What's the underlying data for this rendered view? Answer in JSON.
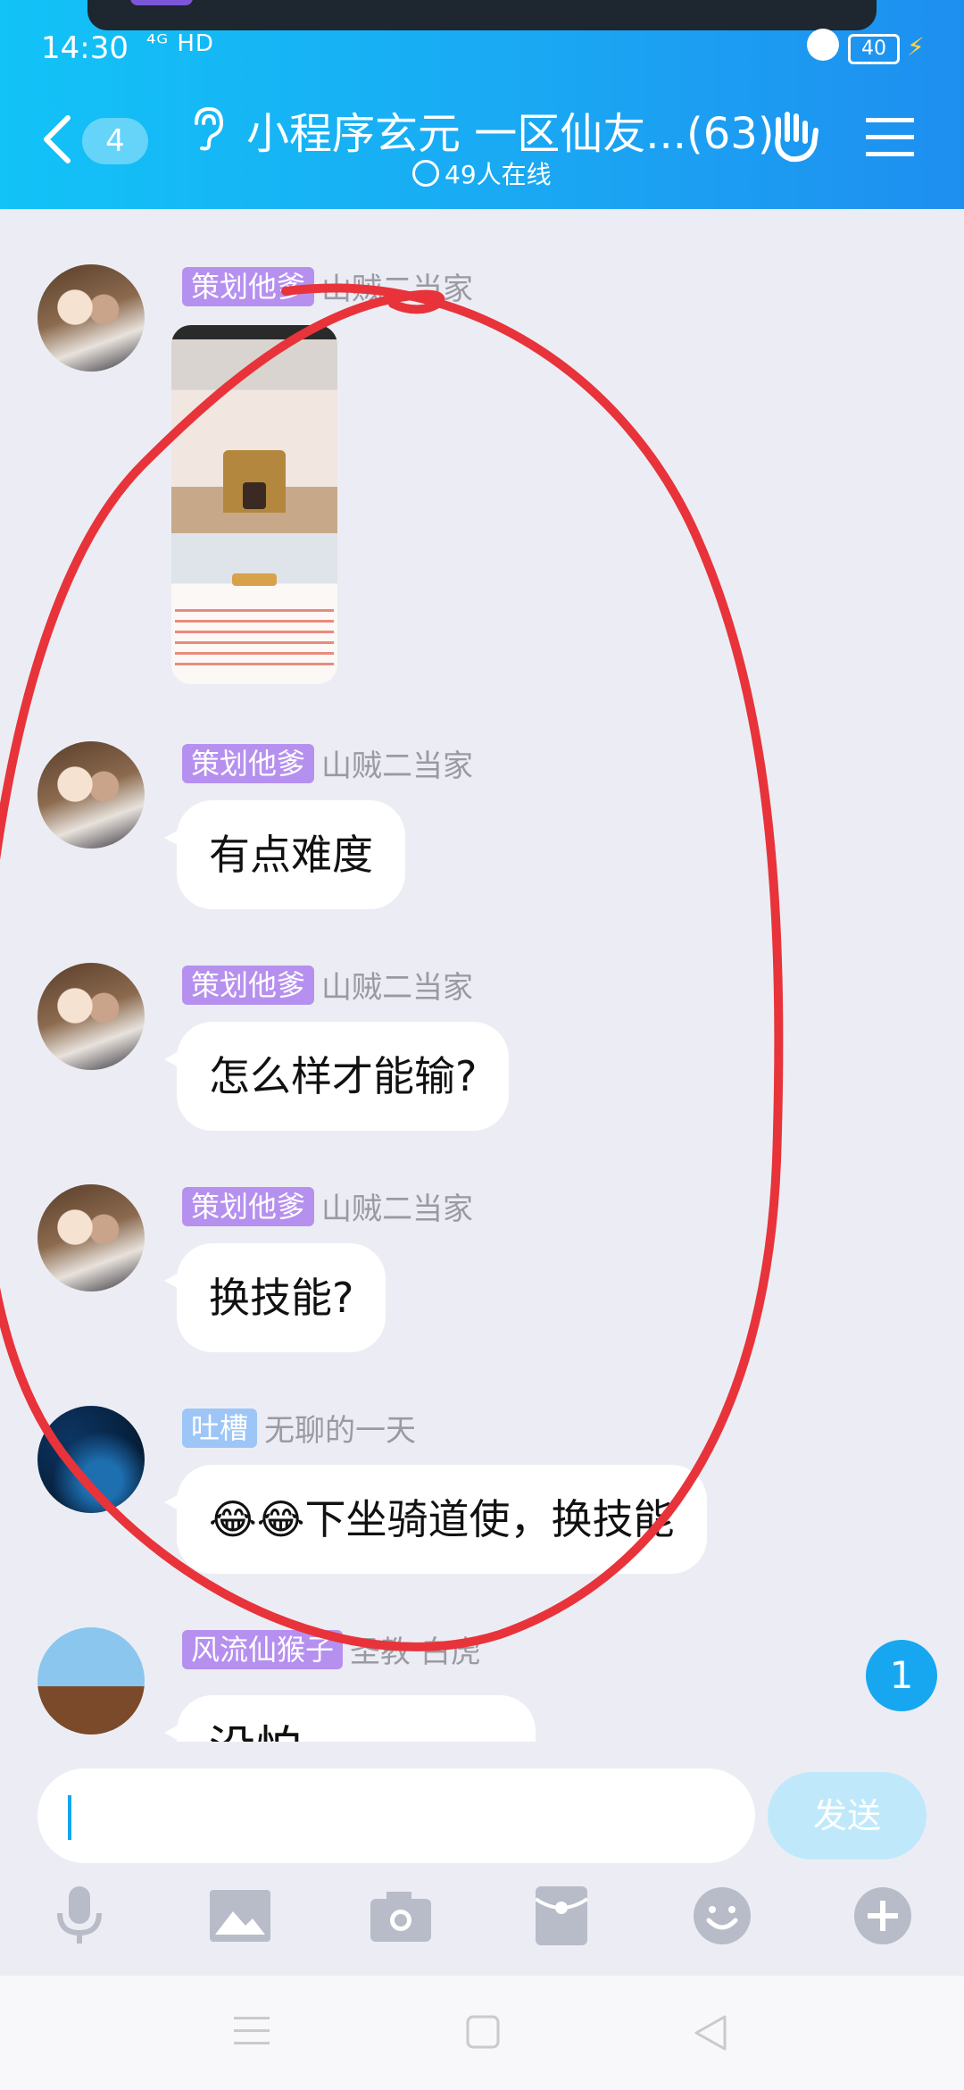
{
  "status_bar": {
    "time": "14:30",
    "network": "⁴ᴳ HD",
    "battery": "40"
  },
  "header": {
    "back_count": "4",
    "title": "小程序玄元 一区仙友...(63)",
    "online": "49人在线"
  },
  "messages": [
    {
      "tag": "策划他爹",
      "tag_color": "#b690ef",
      "nickname": "山贼二当家",
      "type": "image"
    },
    {
      "tag": "策划他爹",
      "tag_color": "#b690ef",
      "nickname": "山贼二当家",
      "text": "有点难度"
    },
    {
      "tag": "策划他爹",
      "tag_color": "#b690ef",
      "nickname": "山贼二当家",
      "text": "怎么样才能输?"
    },
    {
      "tag": "策划他爹",
      "tag_color": "#b690ef",
      "nickname": "山贼二当家",
      "text": "换技能?"
    },
    {
      "tag": "吐槽",
      "tag_color": "#9dc6f6",
      "nickname": "无聊的一天",
      "text": "😂😂下坐骑道使，换技能"
    },
    {
      "tag": "风流仙猴子",
      "tag_color": "#b690ef",
      "nickname": "圣教 白虎",
      "text": "没怕"
    }
  ],
  "unread_badge": "1",
  "input": {
    "placeholder": "",
    "send_label": "发送"
  },
  "toolbar": [
    "microphone-icon",
    "image-icon",
    "camera-icon",
    "red-packet-icon",
    "emoji-icon",
    "plus-icon"
  ],
  "colors": {
    "header_start": "#12c3f7",
    "header_end": "#1e8ff0",
    "annotation": "#e8333a",
    "accent": "#17a7f0"
  }
}
